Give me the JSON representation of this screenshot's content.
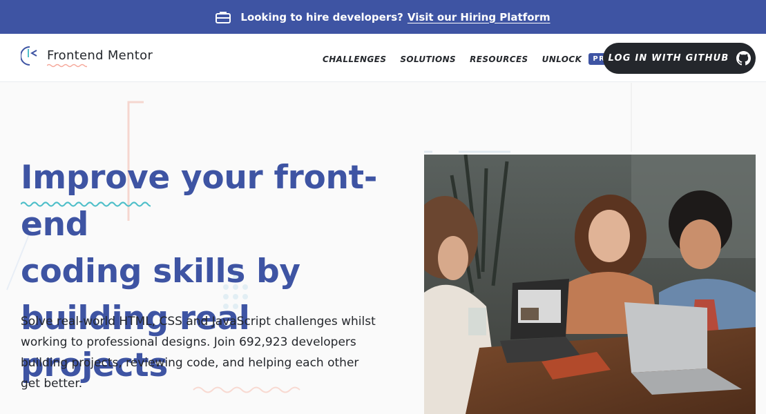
{
  "banner": {
    "text": "Looking to hire developers?",
    "link": "Visit our Hiring Platform",
    "icon": "briefcase-icon"
  },
  "nav": {
    "logo_text": "Frontend Mentor",
    "items": [
      "CHALLENGES",
      "SOLUTIONS",
      "RESOURCES",
      "UNLOCK"
    ],
    "pro_badge": "PRO",
    "login_button": "LOG IN WITH GITHUB",
    "login_icon": "github-icon"
  },
  "hero": {
    "headline_line1": "Improve your front-end",
    "headline_line2": "coding skills by",
    "headline_line3": "building real projects",
    "description": "Solve real-world HTML, CSS and JavaScript challenges whilst working to professional designs. Join 692,923 developers building projects, reviewing code, and helping each other get better."
  },
  "colors": {
    "primary": "#3e54a3",
    "dark": "#24272c",
    "accent_cyan": "#4fbfc9",
    "accent_pink": "#f5a99c"
  }
}
